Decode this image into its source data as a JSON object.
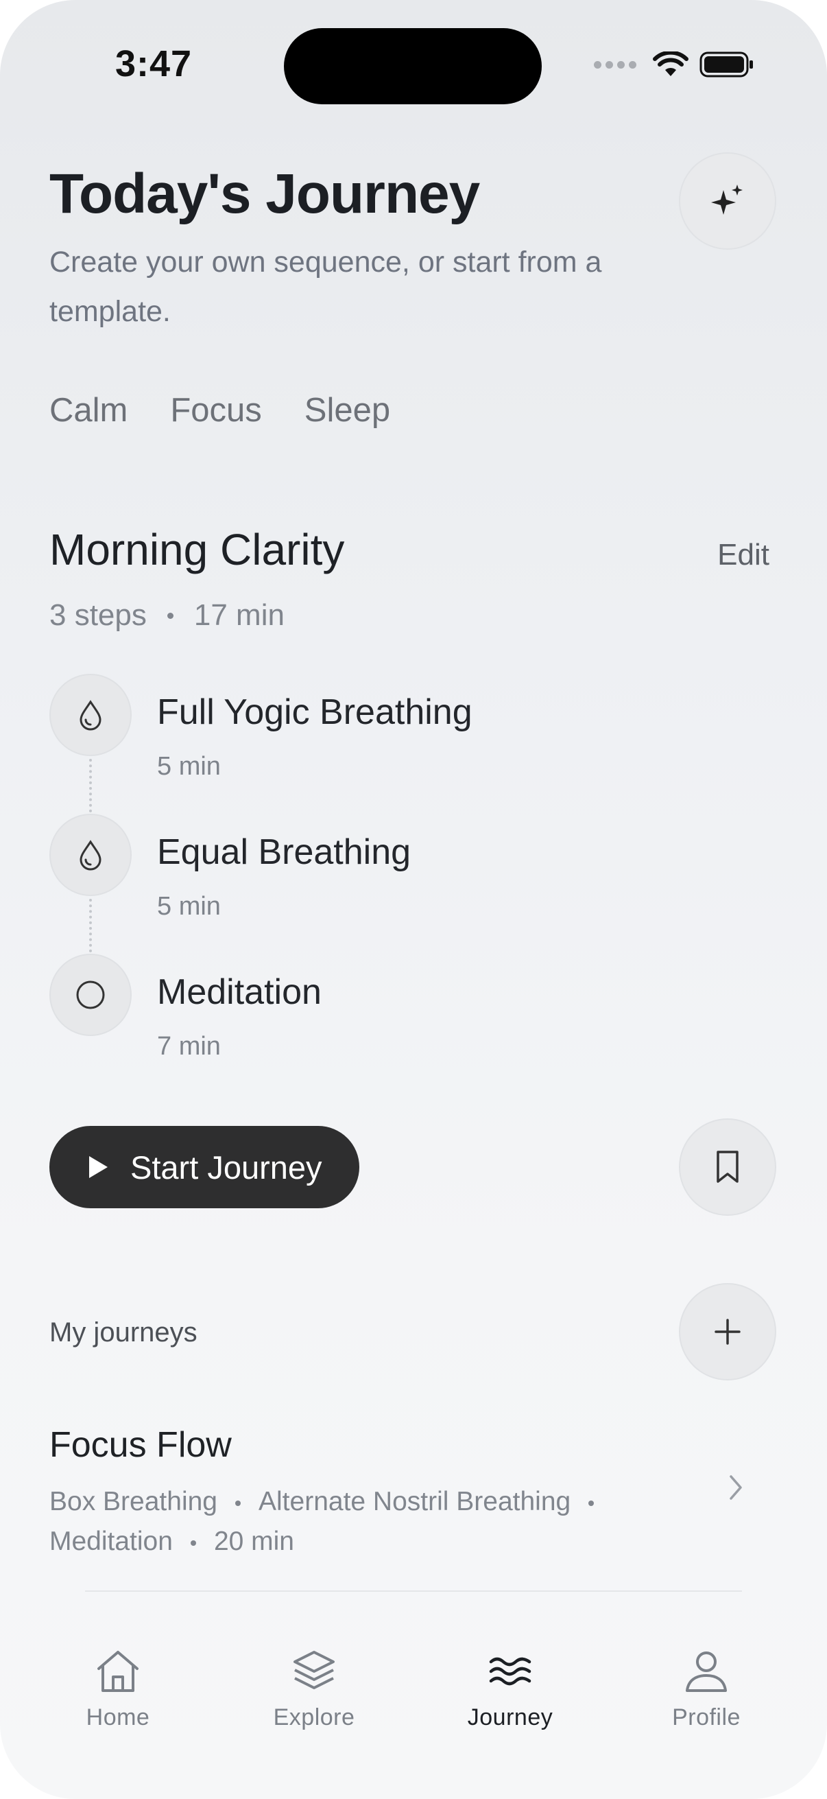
{
  "status_bar": {
    "time": "3:47"
  },
  "header": {
    "title": "Today's Journey",
    "subtitle": "Create your own sequence, or start from a template."
  },
  "categories": [
    "Calm",
    "Focus",
    "Sleep"
  ],
  "journey": {
    "name": "Morning Clarity",
    "edit_label": "Edit",
    "steps_count": "3 steps",
    "total_duration": "17 min",
    "steps": [
      {
        "name": "Full Yogic Breathing",
        "duration": "5 min",
        "icon": "droplet-icon"
      },
      {
        "name": "Equal Breathing",
        "duration": "5 min",
        "icon": "droplet-icon"
      },
      {
        "name": "Meditation",
        "duration": "7 min",
        "icon": "circle-icon"
      }
    ],
    "start_label": "Start Journey"
  },
  "my_journeys": {
    "label": "My journeys",
    "items": [
      {
        "title": "Focus Flow",
        "steps": [
          "Box Breathing",
          "Alternate Nostril Breathing",
          "Meditation"
        ],
        "duration": "20 min"
      }
    ]
  },
  "tabbar": {
    "items": [
      {
        "label": "Home",
        "icon": "home-icon"
      },
      {
        "label": "Explore",
        "icon": "layers-icon"
      },
      {
        "label": "Journey",
        "icon": "waves-icon",
        "active": true
      },
      {
        "label": "Profile",
        "icon": "person-icon"
      }
    ]
  },
  "colors": {
    "background": "#eef0f3",
    "primary_button": "#2e2e2f",
    "text_primary": "#1c1f24",
    "text_secondary": "#80858d"
  }
}
